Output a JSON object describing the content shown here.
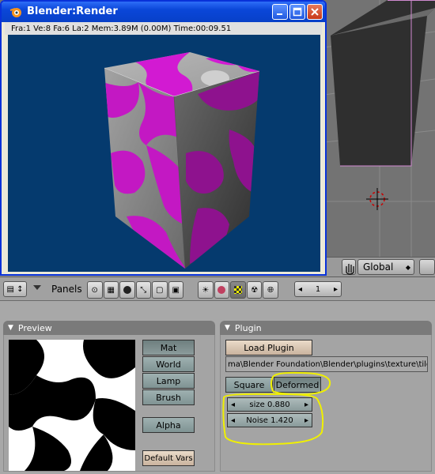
{
  "render_window": {
    "title": "Blender:Render",
    "status": "Fra:1  Ve:8 Fa:6 La:2 Mem:3.89M (0.00M) Time:00:09.51",
    "minimize_icon": "minimize-icon",
    "maximize_icon": "maximize-icon",
    "close_icon": "close-icon"
  },
  "viewport_header": {
    "orientation_value": "Global"
  },
  "buttons_header": {
    "panels_label": "Panels",
    "frame_value": "1"
  },
  "preview_panel": {
    "title": "Preview",
    "buttons": [
      "Mat",
      "World",
      "Lamp",
      "Brush"
    ],
    "alpha_label": "Alpha",
    "default_vars_label": "Default Vars"
  },
  "plugin_panel": {
    "title": "Plugin",
    "load_plugin_label": "Load Plugin",
    "path_value": "ma\\Blender Foundation\\Blender\\plugins\\texture\\tiles.dll",
    "square_label": "Square",
    "deformed_label": "Deformed",
    "size_field": "size 0.880",
    "noise_field": "Noise 1.420"
  },
  "colors": {
    "titlebar": "#0a46d8",
    "render_bg": "#053a6e",
    "magenta": "#d21ad2",
    "annotation": "#f0f000"
  }
}
